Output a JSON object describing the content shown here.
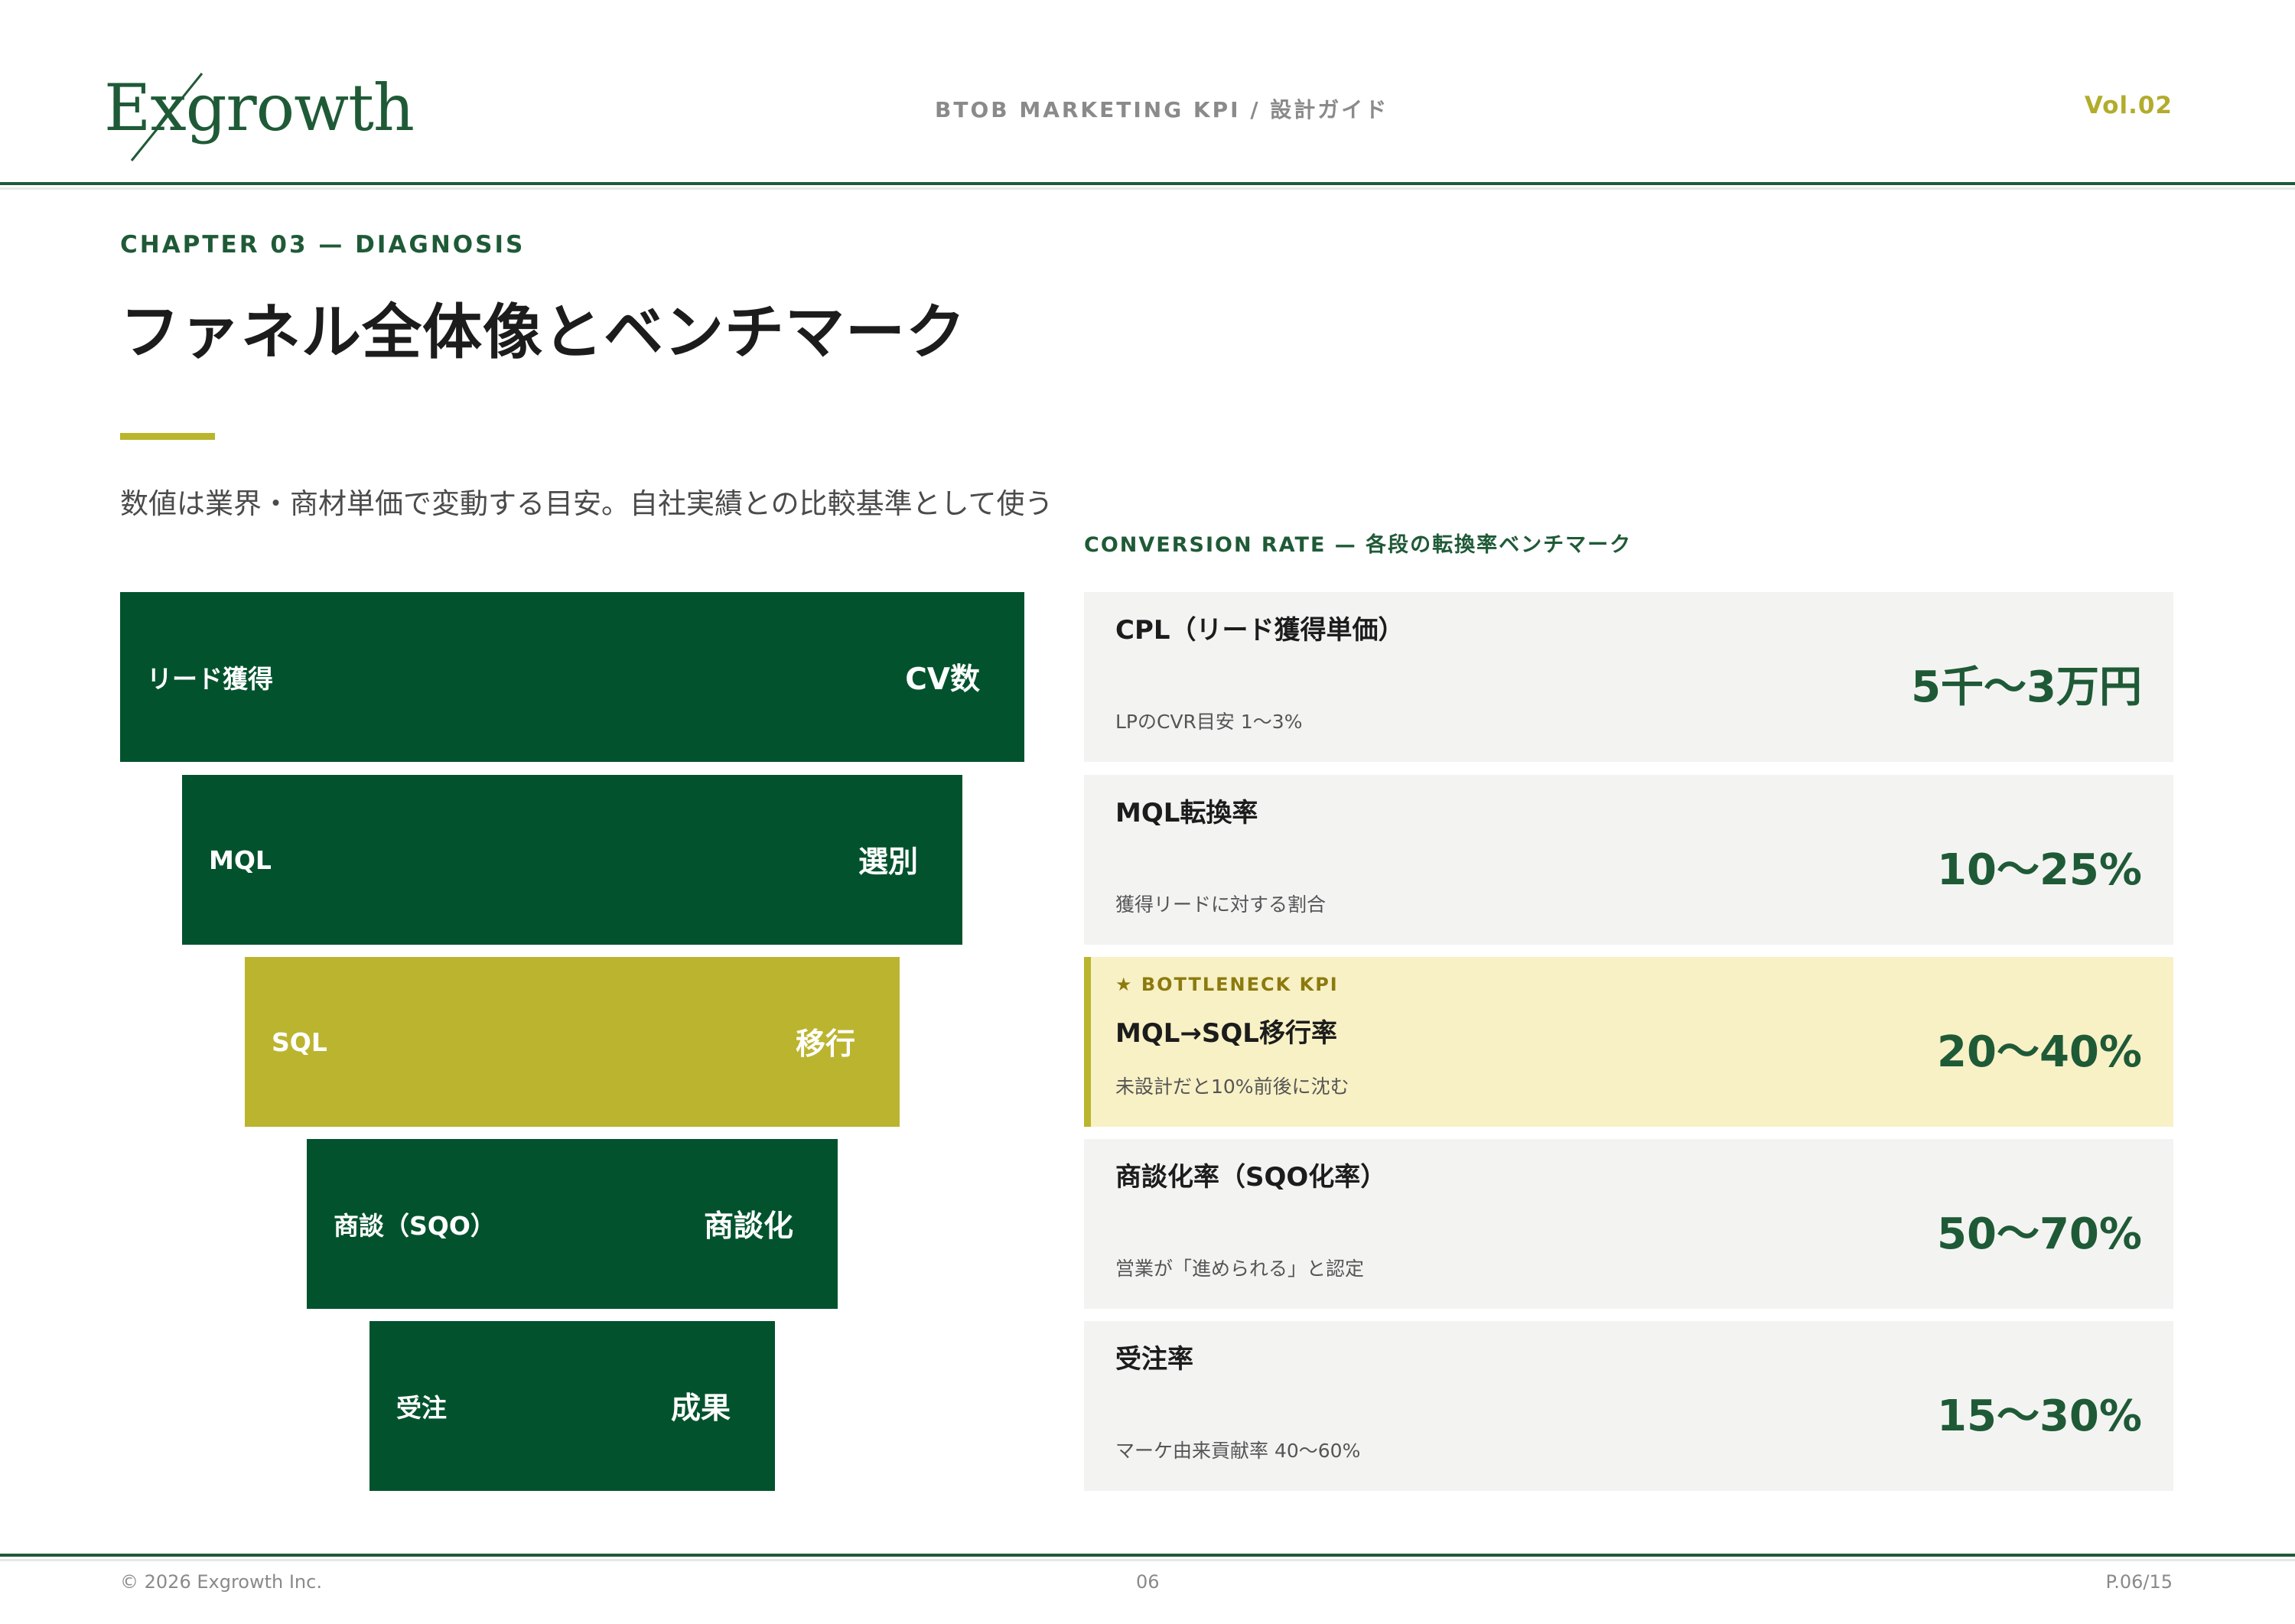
{
  "header": {
    "logo_text": "Exgrowth",
    "center_title": "BTOB MARKETING KPI  /  設計ガイド",
    "volume": "Vol.02"
  },
  "chapter": "CHAPTER 03 — DIAGNOSIS",
  "title": "ファネル全体像とベンチマーク",
  "lead": "数値は業界・商材単価で変動する目安。自社実績との比較基準として使う",
  "section_label": "CONVERSION RATE — 各段の転換率ベンチマーク",
  "funnel": [
    {
      "stage": "リード獲得",
      "outcome": "CV数",
      "color": "#02532d"
    },
    {
      "stage": "MQL",
      "outcome": "選別",
      "color": "#02532d"
    },
    {
      "stage": "SQL",
      "outcome": "移行",
      "color": "#bbb42f"
    },
    {
      "stage": "商談（SQO）",
      "outcome": "商談化",
      "color": "#02532d"
    },
    {
      "stage": "受注",
      "outcome": "成果",
      "color": "#02532d"
    }
  ],
  "metrics": [
    {
      "label": "CPL（リード獲得単価）",
      "value": "5千〜3万円",
      "note": "LPのCVR目安 1〜3%"
    },
    {
      "label": "MQL転換率",
      "value": "10〜25%",
      "note": "獲得リードに対する割合"
    },
    {
      "tag": "★ BOTTLENECK KPI",
      "label": "MQL→SQL移行率",
      "value": "20〜40%",
      "note": "未設計だと10%前後に沈む"
    },
    {
      "label": "商談化率（SQO化率）",
      "value": "50〜70%",
      "note": "営業が「進められる」と認定"
    },
    {
      "label": "受注率",
      "value": "15〜30%",
      "note": "マーケ由来貢献率 40〜60%"
    }
  ],
  "footer": {
    "copyright": "© 2026 Exgrowth Inc.",
    "page_number": "06",
    "page_of": "P.06/15"
  }
}
